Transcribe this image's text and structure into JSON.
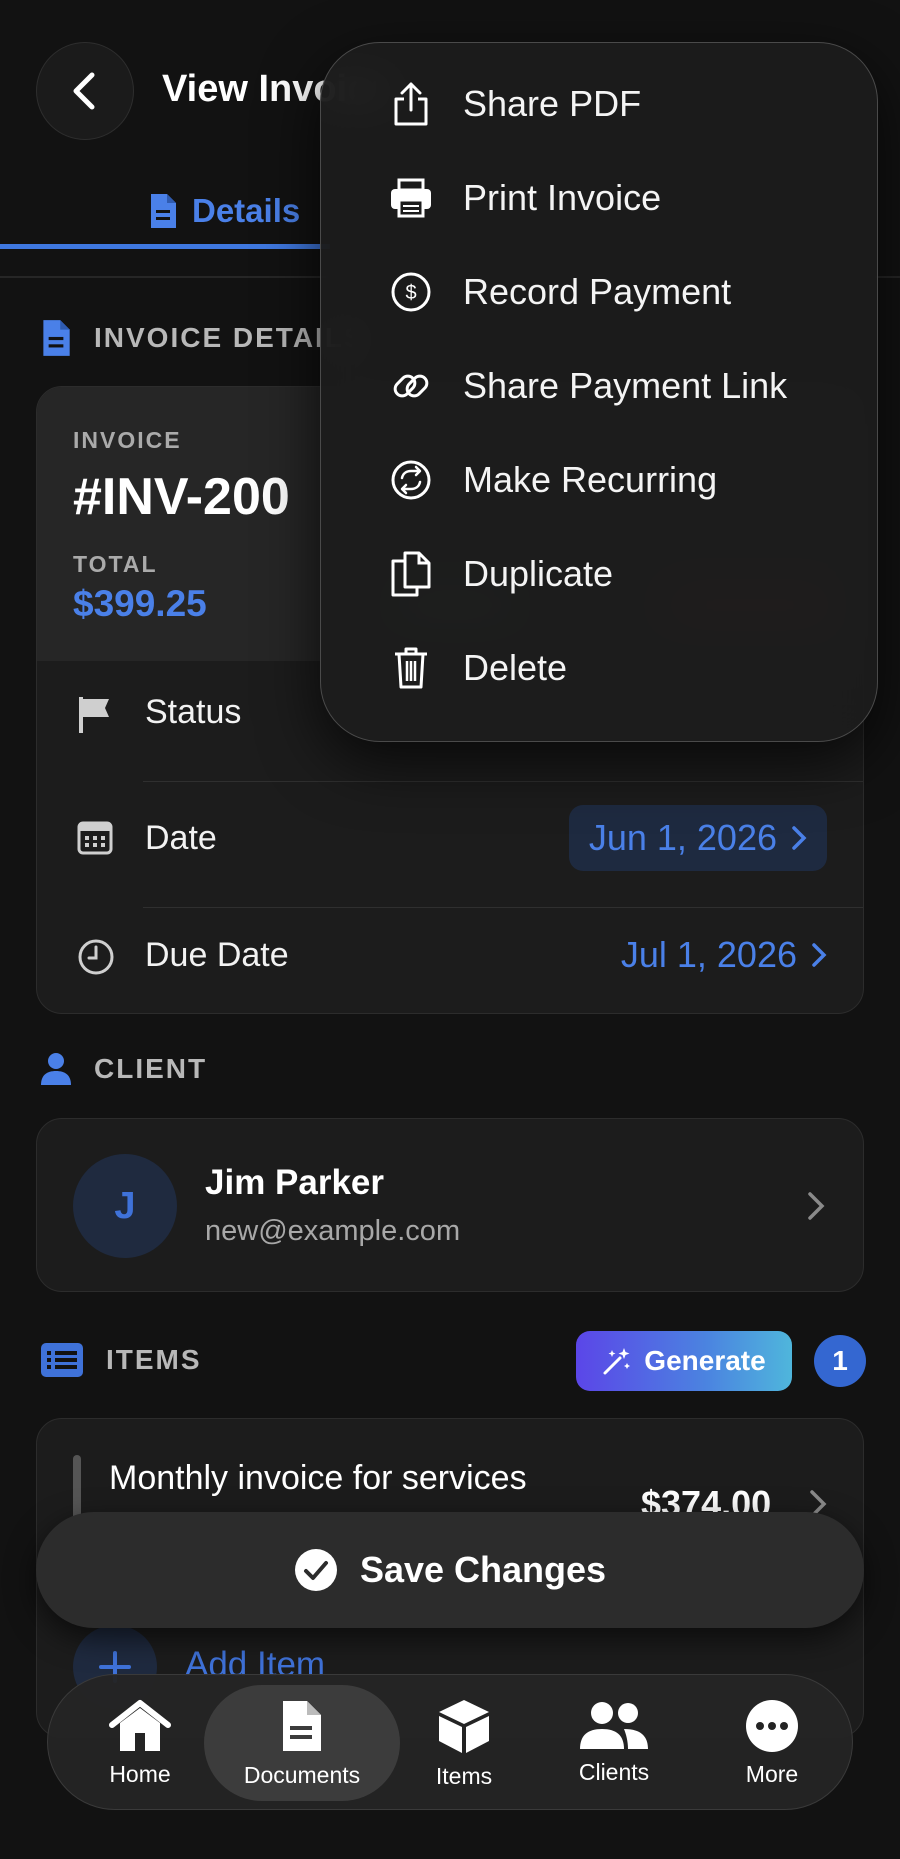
{
  "header": {
    "title": "View Invoice"
  },
  "tabs": {
    "details_label": "Details"
  },
  "invoice_section": {
    "heading": "INVOICE DETAILS",
    "invoice_label": "INVOICE",
    "invoice_number": "#INV-200",
    "total_label": "TOTAL",
    "total_value": "$399.25"
  },
  "rows": {
    "status_label": "Status",
    "date_label": "Date",
    "date_value": "Jun 1, 2026",
    "due_label": "Due Date",
    "due_value": "Jul 1, 2026"
  },
  "client_section": {
    "heading": "CLIENT",
    "initial": "J",
    "name": "Jim Parker",
    "email": "new@example.com"
  },
  "items_section": {
    "heading": "ITEMS",
    "generate_label": "Generate",
    "count": "1",
    "item_description": "Monthly invoice for services",
    "item_amount": "$374.00",
    "add_item_label": "Add Item"
  },
  "save_label": "Save Changes",
  "tabbar": {
    "home": "Home",
    "documents": "Documents",
    "items": "Items",
    "clients": "Clients",
    "more": "More"
  },
  "menu": {
    "share_pdf": "Share PDF",
    "print_invoice": "Print Invoice",
    "record_payment": "Record Payment",
    "share_payment_link": "Share Payment Link",
    "make_recurring": "Make Recurring",
    "duplicate": "Duplicate",
    "delete": "Delete"
  },
  "colors": {
    "accent": "#4a80e8",
    "background": "#121212",
    "card": "#1c1c1c"
  }
}
